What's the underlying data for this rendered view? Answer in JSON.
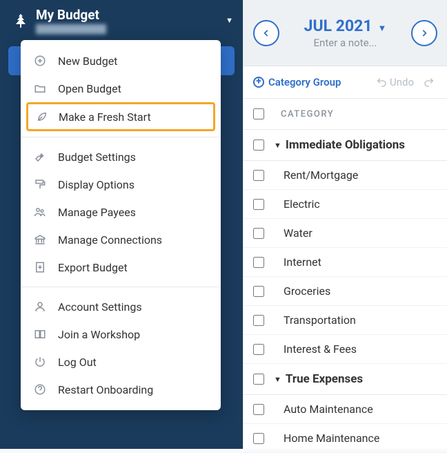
{
  "header": {
    "title": "My Budget",
    "subtitle": "████████████"
  },
  "menu": {
    "section1": [
      {
        "icon": "plus-circle-icon",
        "label": "New Budget"
      },
      {
        "icon": "folder-icon",
        "label": "Open Budget"
      },
      {
        "icon": "leaf-icon",
        "label": "Make a Fresh Start",
        "highlighted": true
      }
    ],
    "section2": [
      {
        "icon": "wrench-icon",
        "label": "Budget Settings"
      },
      {
        "icon": "paint-roller-icon",
        "label": "Display Options"
      },
      {
        "icon": "people-icon",
        "label": "Manage Payees"
      },
      {
        "icon": "bank-icon",
        "label": "Manage Connections"
      },
      {
        "icon": "export-icon",
        "label": "Export Budget"
      }
    ],
    "section3": [
      {
        "icon": "person-icon",
        "label": "Account Settings"
      },
      {
        "icon": "book-icon",
        "label": "Join a Workshop"
      },
      {
        "icon": "power-icon",
        "label": "Log Out"
      },
      {
        "icon": "help-circle-icon",
        "label": "Restart Onboarding"
      }
    ]
  },
  "month_nav": {
    "label": "JUL 2021",
    "note_placeholder": "Enter a note..."
  },
  "toolbar": {
    "add_group_label": "Category Group",
    "undo_label": "Undo",
    "redo_label": ""
  },
  "category_header": "CATEGORY",
  "groups": [
    {
      "name": "Immediate Obligations",
      "categories": [
        "Rent/Mortgage",
        "Electric",
        "Water",
        "Internet",
        "Groceries",
        "Transportation",
        "Interest & Fees"
      ]
    },
    {
      "name": "True Expenses",
      "categories": [
        "Auto Maintenance",
        "Home Maintenance"
      ]
    }
  ]
}
